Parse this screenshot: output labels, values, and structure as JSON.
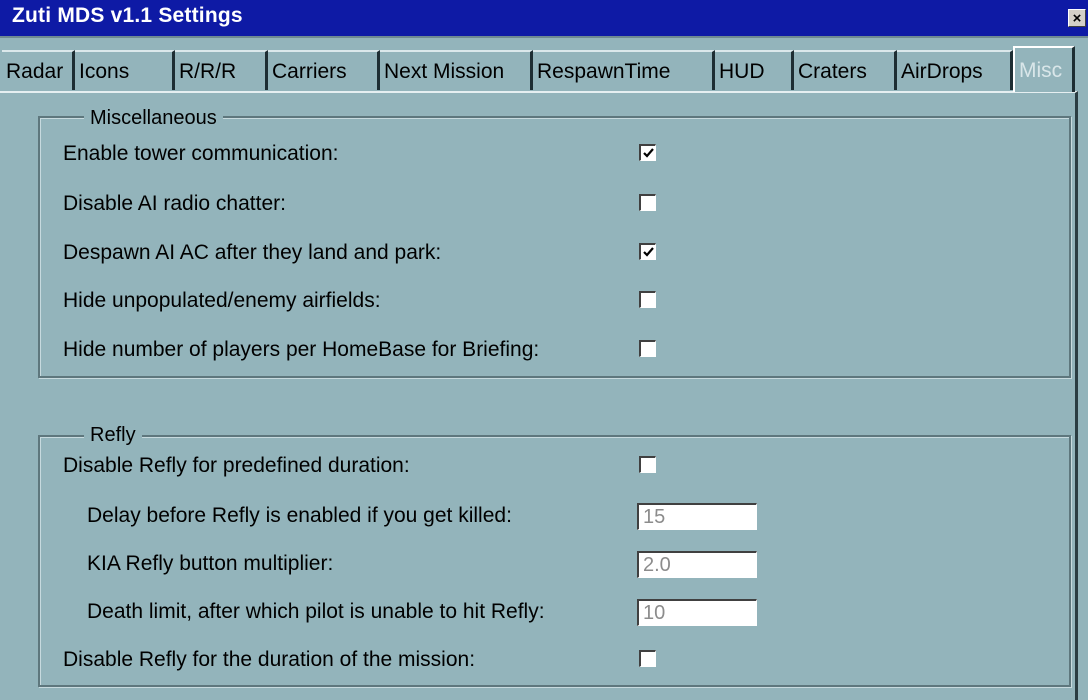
{
  "window": {
    "title": "Zuti MDS v1.1 Settings"
  },
  "tabs": [
    {
      "label": "Radar"
    },
    {
      "label": "Icons"
    },
    {
      "label": "R/R/R"
    },
    {
      "label": "Carriers"
    },
    {
      "label": "Next Mission"
    },
    {
      "label": "RespawnTime"
    },
    {
      "label": "HUD"
    },
    {
      "label": "Craters"
    },
    {
      "label": "AirDrops"
    },
    {
      "label": "Misc",
      "selected": true
    }
  ],
  "miscellaneous": {
    "legend": "Miscellaneous",
    "options": [
      {
        "label": "Enable tower communication:",
        "checked": true
      },
      {
        "label": "Disable AI radio chatter:",
        "checked": false
      },
      {
        "label": "Despawn AI AC after they land and park:",
        "checked": true
      },
      {
        "label": "Hide unpopulated/enemy airfields:",
        "checked": false
      },
      {
        "label": "Hide number of players per HomeBase for Briefing:",
        "checked": false
      }
    ]
  },
  "refly": {
    "legend": "Refly",
    "disable_predefined": {
      "label": "Disable Refly for predefined duration:",
      "checked": false
    },
    "fields": [
      {
        "label": "Delay before Refly is enabled if you get killed:",
        "value": "15"
      },
      {
        "label": "KIA Refly button multiplier:",
        "value": "2.0"
      },
      {
        "label": "Death limit, after which pilot is unable to hit Refly:",
        "value": "10"
      }
    ],
    "disable_mission": {
      "label": "Disable Refly for the duration of the mission:",
      "checked": false
    }
  }
}
